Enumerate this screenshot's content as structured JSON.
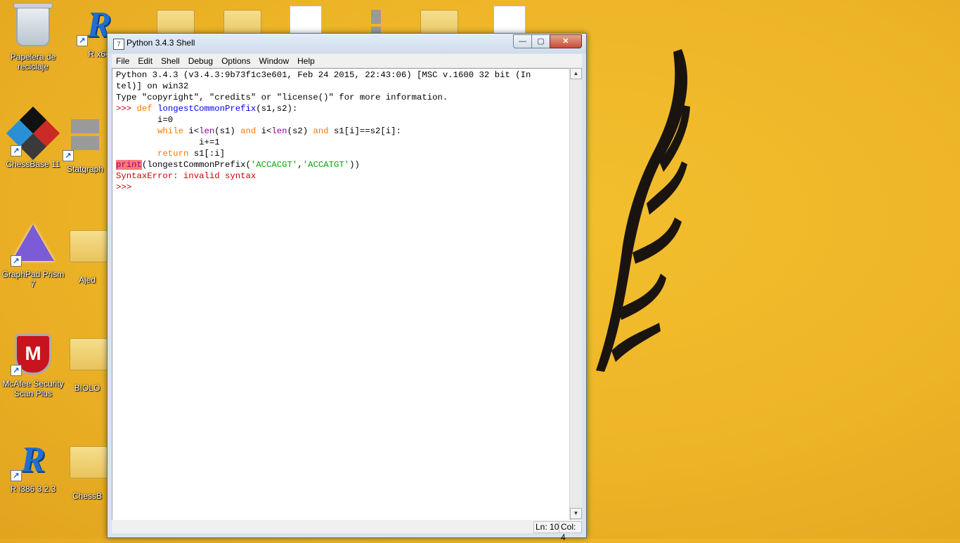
{
  "desktop": {
    "icons": [
      {
        "label": "Papelera de reciclaje"
      },
      {
        "label": "R x64"
      },
      {
        "label": "ChessBase 11"
      },
      {
        "label": "Statgraph"
      },
      {
        "label": "GraphPad Prism 7"
      },
      {
        "label": "Ajed"
      },
      {
        "label": "McAfee Security Scan Plus"
      },
      {
        "label": "BIOLO"
      },
      {
        "label": "R i386 3.2.3"
      },
      {
        "label": "ChessB"
      }
    ]
  },
  "window": {
    "title": "Python 3.4.3 Shell",
    "controls": {
      "minimize": "—",
      "maximize": "▢",
      "close": "✕"
    },
    "menu": [
      "File",
      "Edit",
      "Shell",
      "Debug",
      "Options",
      "Window",
      "Help"
    ],
    "shell": {
      "banner1": "Python 3.4.3 (v3.4.3:9b73f1c3e601, Feb 24 2015, 22:43:06) [MSC v.1600 32 bit (In",
      "banner2": "tel)] on win32",
      "banner3": "Type \"copyright\", \"credits\" or \"license()\" for more information.",
      "prompt": ">>>",
      "def_kw": "def",
      "fn_name": "longestCommonPrefix",
      "def_args": "(s1,s2):",
      "line_i0": "i=0",
      "while_kw": "while",
      "while_a": " i<",
      "len1": "len",
      "while_b": "(s1) ",
      "and1": "and",
      "while_c": " i<",
      "len2": "len",
      "while_d": "(s2) ",
      "and2": "and",
      "while_e": " s1[i]==s2[i]:",
      "line_inc": "i+=1",
      "return_kw": "return",
      "return_rest": " s1[:i]",
      "print_kw": "print",
      "print_a": "(longestCommonPrefix(",
      "str1": "'ACCACGT'",
      "comma": ",",
      "str2": "'ACCATGT'",
      "print_b": "))",
      "error": "SyntaxError: invalid syntax",
      "prompt_final": ">>>"
    },
    "status": {
      "line": "Ln: 10",
      "col": "Col: 4"
    }
  },
  "colors": {
    "desktop": "#edb427",
    "keyword": "#ff7700",
    "builtin": "#900090",
    "definition": "#0000ff",
    "string": "#00aa00",
    "error": "#cc0000",
    "error_highlight": "#ff7777"
  }
}
